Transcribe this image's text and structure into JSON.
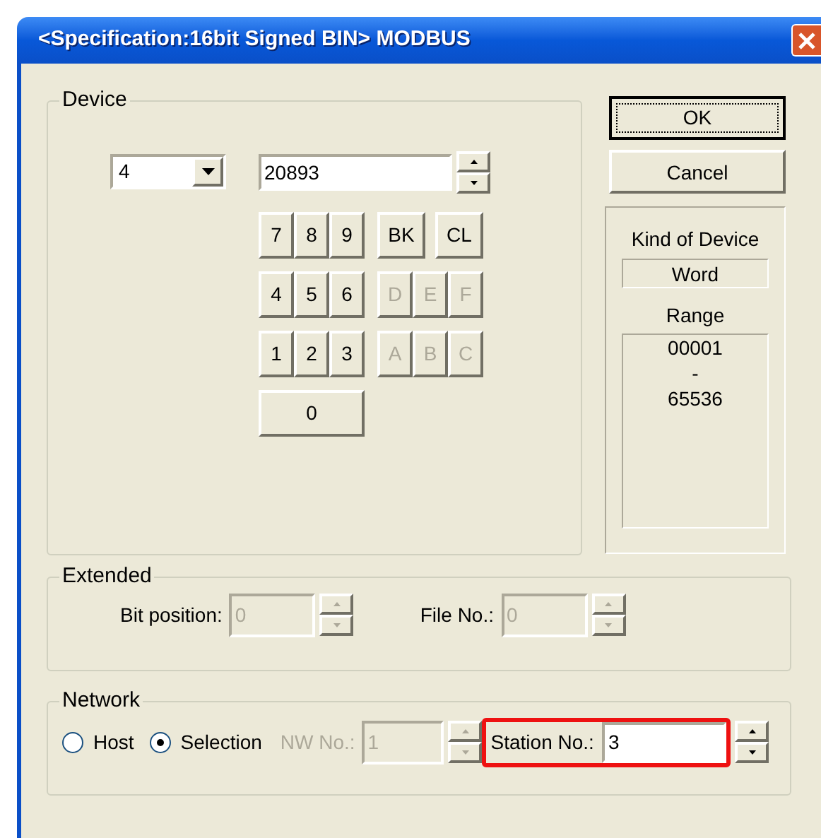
{
  "window": {
    "title": "<Specification:16bit Signed BIN> MODBUS"
  },
  "device": {
    "label": "Device",
    "type_combo": {
      "value": "4"
    },
    "address": {
      "value": "20893"
    },
    "keypad": {
      "rows": [
        {
          "keys": [
            {
              "label": "7",
              "kind": "digit",
              "disabled": false
            },
            {
              "label": "8",
              "kind": "digit",
              "disabled": false
            },
            {
              "label": "9",
              "kind": "digit",
              "disabled": false
            },
            {
              "label": "BK",
              "kind": "command",
              "disabled": false
            },
            {
              "label": "CL",
              "kind": "command",
              "disabled": false
            }
          ]
        },
        {
          "keys": [
            {
              "label": "4",
              "kind": "digit",
              "disabled": false
            },
            {
              "label": "5",
              "kind": "digit",
              "disabled": false
            },
            {
              "label": "6",
              "kind": "digit",
              "disabled": false
            },
            {
              "label": "D",
              "kind": "hex",
              "disabled": true
            },
            {
              "label": "E",
              "kind": "hex",
              "disabled": true
            },
            {
              "label": "F",
              "kind": "hex",
              "disabled": true
            }
          ]
        },
        {
          "keys": [
            {
              "label": "1",
              "kind": "digit",
              "disabled": false
            },
            {
              "label": "2",
              "kind": "digit",
              "disabled": false
            },
            {
              "label": "3",
              "kind": "digit",
              "disabled": false
            },
            {
              "label": "A",
              "kind": "hex",
              "disabled": true
            },
            {
              "label": "B",
              "kind": "hex",
              "disabled": true
            },
            {
              "label": "C",
              "kind": "hex",
              "disabled": true
            }
          ]
        },
        {
          "keys": [
            {
              "label": "0",
              "kind": "zero",
              "disabled": false
            }
          ]
        }
      ]
    }
  },
  "buttons": [
    {
      "label": "OK",
      "default": true
    },
    {
      "label": "Cancel",
      "default": false
    }
  ],
  "kind_panel": {
    "heading": "Kind of Device",
    "value": "Word",
    "range_heading": "Range",
    "range": [
      "00001",
      "-",
      "65536"
    ]
  },
  "extended": {
    "label": "Extended",
    "fields": [
      {
        "label": "Bit position:",
        "value": "0",
        "disabled": true
      },
      {
        "label": "File No.:",
        "value": "0",
        "disabled": true
      }
    ]
  },
  "network": {
    "label": "Network",
    "radios": [
      {
        "label": "Host",
        "selected": false
      },
      {
        "label": "Selection",
        "selected": true
      }
    ],
    "nw_no": {
      "label": "NW No.:",
      "value": "1",
      "disabled": true
    },
    "station_no": {
      "label": "Station No.:",
      "value": "3",
      "disabled": false,
      "highlighted": true
    }
  }
}
